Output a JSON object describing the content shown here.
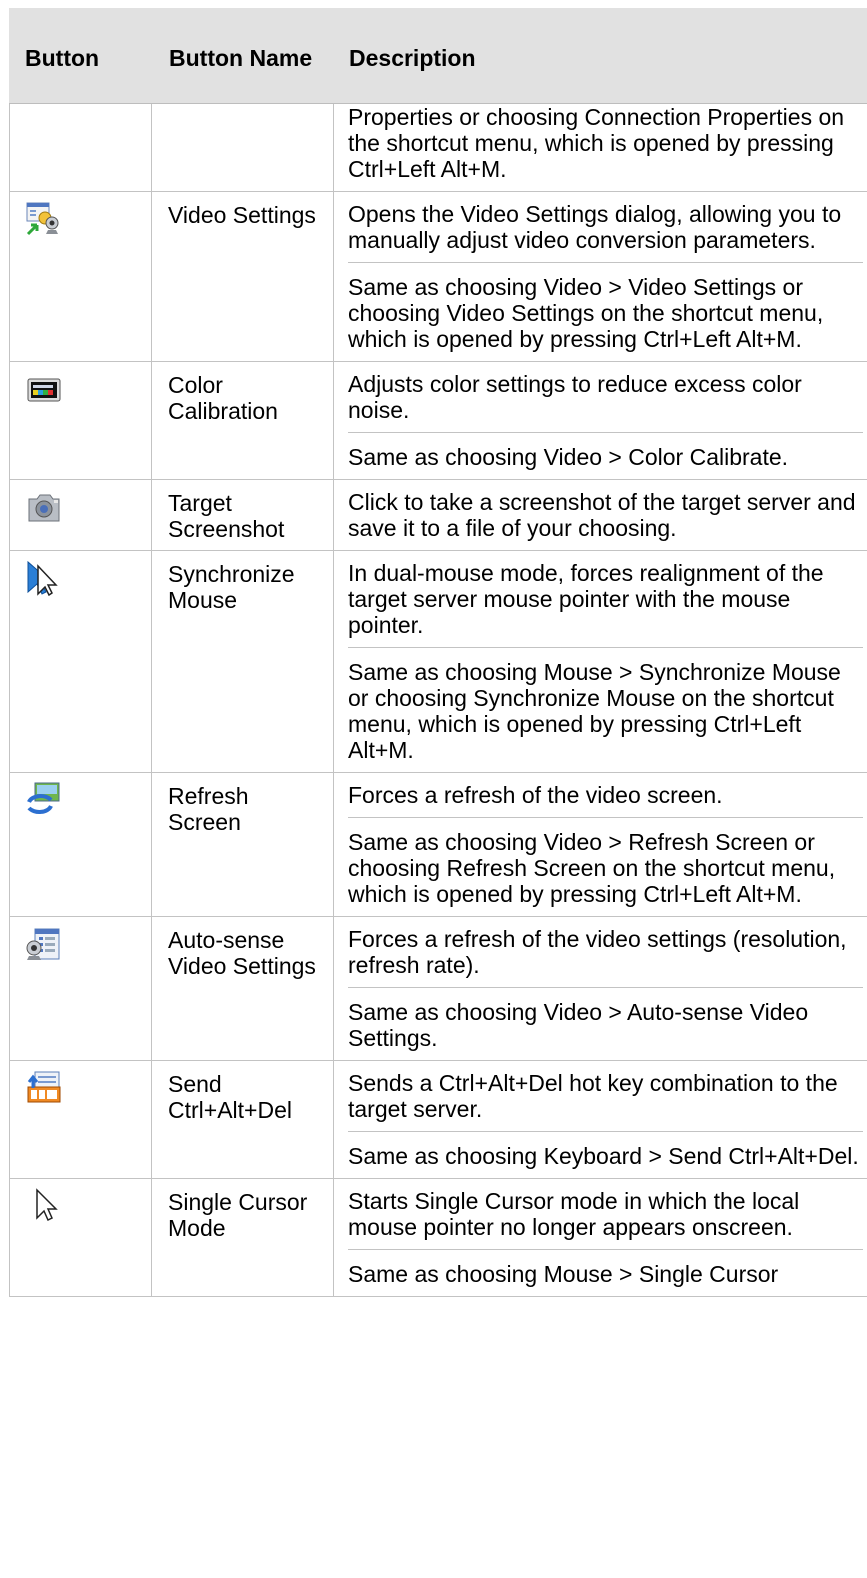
{
  "header": {
    "button": "Button",
    "button_name": "Button Name",
    "description": "Description"
  },
  "rows": [
    {
      "icon": "",
      "name": "",
      "paras": [
        "Properties or choosing Connection Properties on the shortcut menu, which is opened by pressing Ctrl+Left Alt+M."
      ]
    },
    {
      "icon": "video-settings-icon",
      "name": "Video Settings",
      "paras": [
        "Opens the Video Settings dialog, allowing you to manually adjust video conversion parameters.",
        "Same as choosing Video > Video Settings or choosing Video Settings on the shortcut menu, which is opened by pressing Ctrl+Left Alt+M."
      ]
    },
    {
      "icon": "color-calibration-icon",
      "name": "Color Calibration",
      "paras": [
        "Adjusts color settings to reduce excess color noise.",
        "Same as choosing Video > Color Calibrate."
      ]
    },
    {
      "icon": "camera-icon",
      "name": "Target Screenshot",
      "paras": [
        "Click to take a screenshot of the target server and save it to a file of your choosing."
      ]
    },
    {
      "icon": "synchronize-mouse-icon",
      "name": "Synchronize Mouse",
      "paras": [
        "In dual-mouse mode, forces realignment of the target server mouse pointer with the mouse pointer.",
        "Same as choosing Mouse > Synchronize Mouse or choosing Synchronize Mouse on the shortcut menu, which is opened by pressing Ctrl+Left Alt+M."
      ]
    },
    {
      "icon": "refresh-screen-icon",
      "name": "Refresh Screen",
      "paras": [
        "Forces a refresh of the video screen.",
        "Same as choosing Video > Refresh Screen or choosing Refresh Screen on the shortcut menu, which is opened by pressing Ctrl+Left Alt+M."
      ]
    },
    {
      "icon": "auto-sense-video-icon",
      "name": "Auto-sense Video Settings",
      "paras": [
        "Forces a refresh of the video settings (resolution, refresh rate).",
        "Same as choosing Video > Auto-sense Video Settings."
      ]
    },
    {
      "icon": "send-ctrl-alt-del-icon",
      "name": "Send Ctrl+Alt+Del",
      "paras": [
        "Sends a Ctrl+Alt+Del hot key combination to the target server.",
        "Same as choosing Keyboard > Send Ctrl+Alt+Del."
      ]
    },
    {
      "icon": "single-cursor-icon",
      "name": "Single Cursor Mode",
      "paras": [
        "Starts Single Cursor mode in which the local mouse pointer no longer appears onscreen.",
        "Same as choosing Mouse > Single Cursor"
      ]
    }
  ]
}
